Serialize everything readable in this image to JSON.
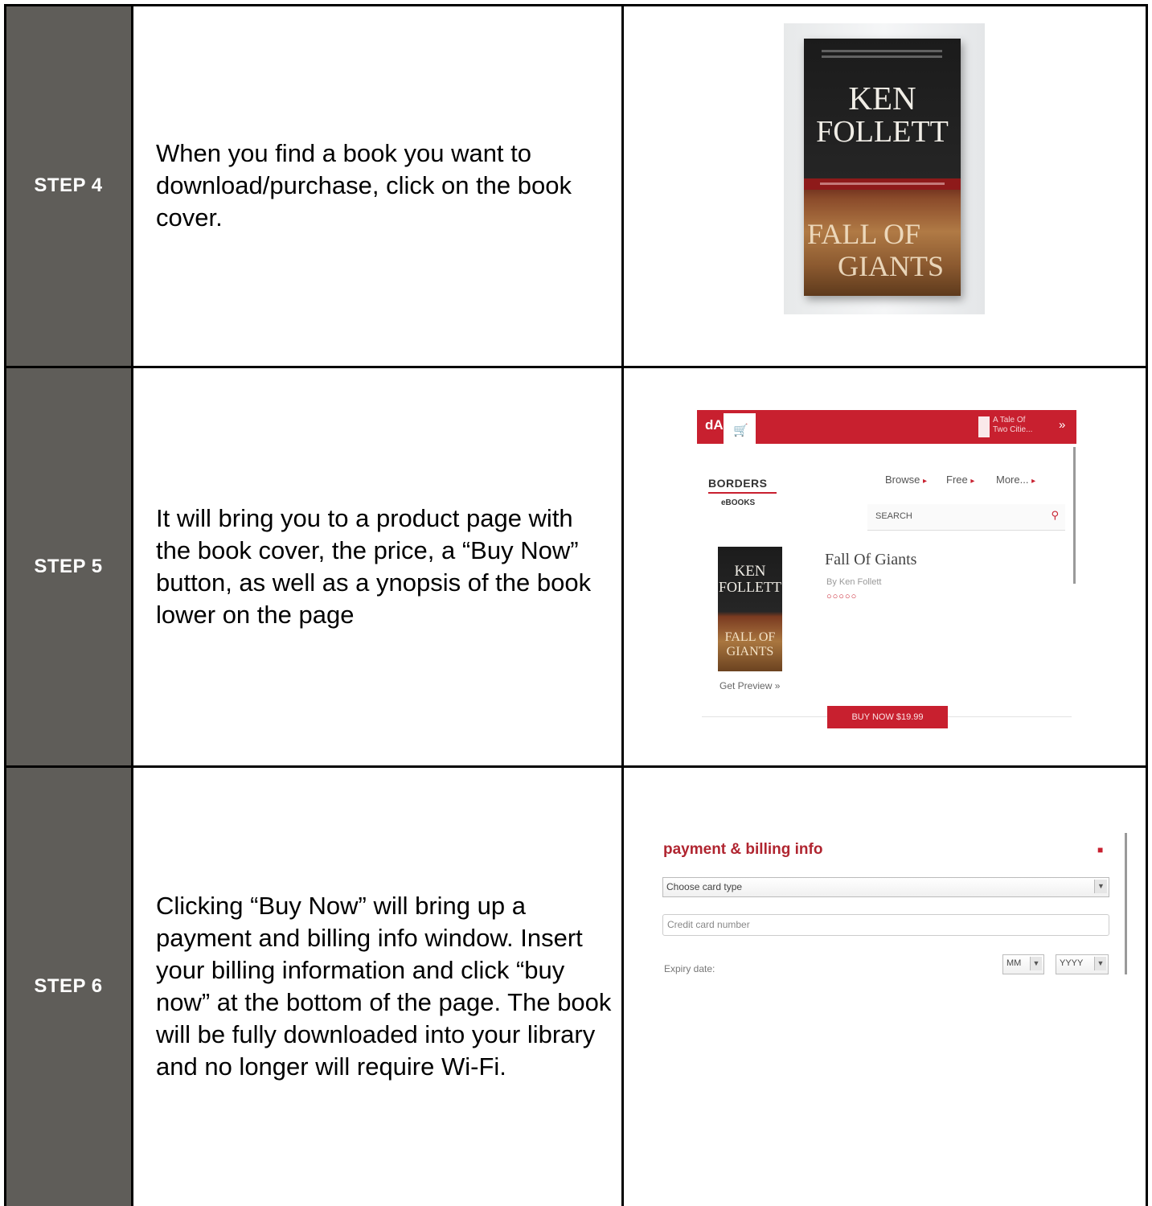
{
  "steps": [
    {
      "label": "STEP 4",
      "text": "When you find a book you want to download/purchase, click on the book cover.",
      "cover": {
        "author_line1": "KEN",
        "author_line2": "FOLLETT",
        "title_line1": "FALL OF",
        "title_line2": "GIANTS"
      }
    },
    {
      "label": "STEP 5",
      "text": "It will bring you to a product page with the book cover, the price, a “Buy Now” button, as well as a ynopsis of the book lower on the page",
      "store": {
        "logo": "dA",
        "cart_icon": "🛒",
        "mini_title": "A Tale Of Two Citie...",
        "more_icon": "»",
        "brand": "BORDERS",
        "brand_sub": "eBOOKS",
        "nav": [
          "Browse",
          "Free",
          "More..."
        ],
        "search_placeholder": "SEARCH",
        "book_title": "Fall Of Giants",
        "book_author": "By Ken Follett",
        "stars": "○○○○○",
        "thumb_author1": "KEN",
        "thumb_author2": "FOLLETT",
        "thumb_title1": "FALL OF",
        "thumb_title2": "GIANTS",
        "preview": "Get Preview »",
        "buy_label": "BUY NOW $19.99"
      }
    },
    {
      "label": "STEP 6",
      "text": "Clicking “Buy Now” will bring up a payment and billing info window. Insert your billing information and click “buy now” at the bottom of the page.  The book will be fully downloaded into your library and no longer will require Wi-Fi.",
      "payment": {
        "title": "payment & billing info",
        "card_type": "Choose card type",
        "card_number_placeholder": "Credit card number",
        "expiry_label": "Expiry date:",
        "month": "MM",
        "year": "YYYY"
      }
    }
  ],
  "colors": {
    "step_label_bg": "#5f5d59",
    "brand_red": "#c8202f"
  }
}
